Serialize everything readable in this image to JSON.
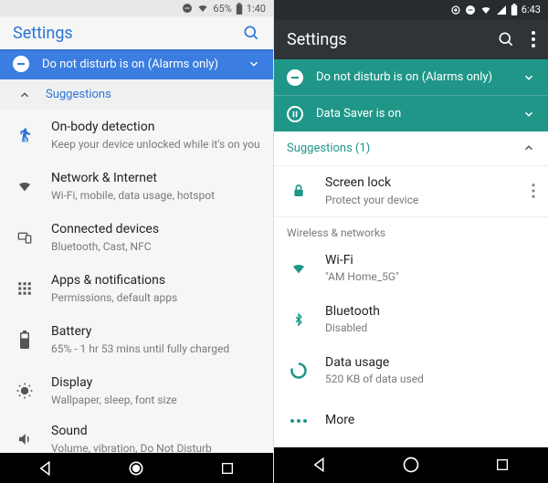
{
  "left": {
    "status": {
      "battery": "65%",
      "time": "1:40"
    },
    "title": "Settings",
    "banner_dnd": "Do not disturb is on (Alarms only)",
    "suggestions_label": "Suggestions",
    "suggestion": {
      "title": "On-body detection",
      "sub": "Keep your device unlocked while it's on you"
    },
    "items": [
      {
        "title": "Network & Internet",
        "sub": "Wi-Fi, mobile, data usage, hotspot"
      },
      {
        "title": "Connected devices",
        "sub": "Bluetooth, Cast, NFC"
      },
      {
        "title": "Apps & notifications",
        "sub": "Permissions, default apps"
      },
      {
        "title": "Battery",
        "sub": "65% - 1 hr 53 mins until fully charged"
      },
      {
        "title": "Display",
        "sub": "Wallpaper, sleep, font size"
      },
      {
        "title": "Sound",
        "sub": "Volume, vibration, Do Not Disturb"
      }
    ]
  },
  "right": {
    "status": {
      "time": "6:43"
    },
    "title": "Settings",
    "banner_dnd": "Do not disturb is on (Alarms only)",
    "banner_data_saver": "Data Saver is on",
    "suggestions_label": "Suggestions (1)",
    "suggestion": {
      "title": "Screen lock",
      "sub": "Protect your device"
    },
    "section_label": "Wireless & networks",
    "items": [
      {
        "title": "Wi-Fi",
        "sub": "\"AM Home_5G\""
      },
      {
        "title": "Bluetooth",
        "sub": "Disabled"
      },
      {
        "title": "Data usage",
        "sub": "520 KB of data used"
      },
      {
        "title": "More",
        "sub": ""
      }
    ]
  }
}
